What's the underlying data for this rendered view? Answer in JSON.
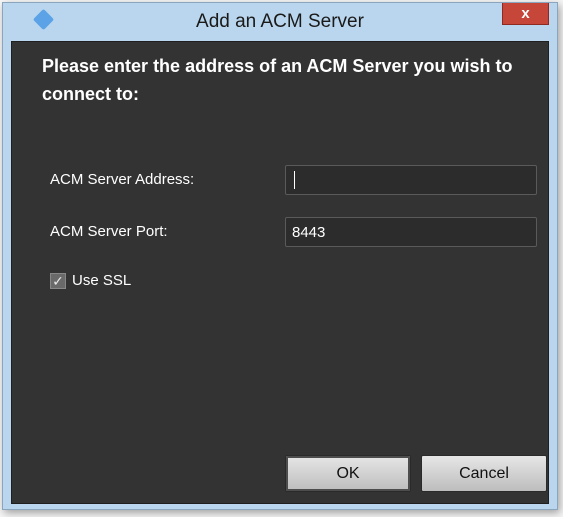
{
  "window": {
    "title": "Add an ACM Server",
    "close_label": "x"
  },
  "form": {
    "prompt": "Please enter the address of an ACM Server you wish to connect to:",
    "address_label": "ACM Server Address:",
    "address_value": "",
    "port_label": "ACM Server Port:",
    "port_value": "8443",
    "ssl_label": "Use SSL",
    "ssl_checked": true,
    "ssl_check_glyph": "✓"
  },
  "buttons": {
    "ok_label": "OK",
    "cancel_label": "Cancel"
  },
  "colors": {
    "titlebar": "#b9d6ee",
    "content_background": "#333333",
    "close_button": "#c7463a"
  }
}
